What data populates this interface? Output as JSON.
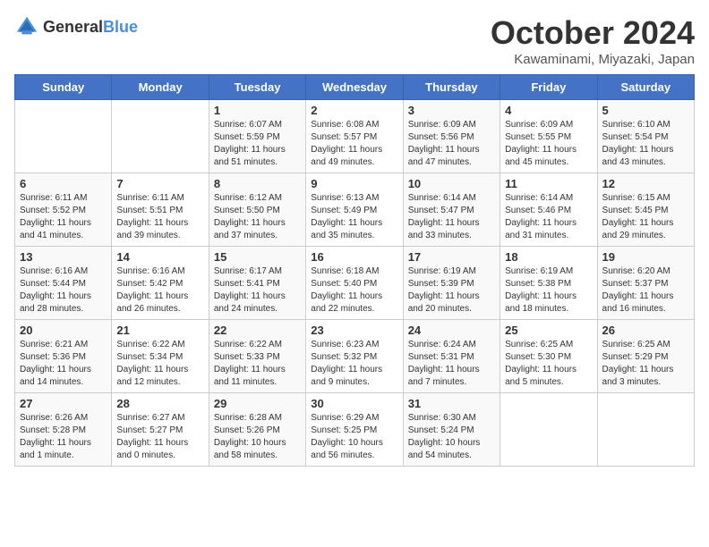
{
  "logo": {
    "text_general": "General",
    "text_blue": "Blue"
  },
  "title": "October 2024",
  "location": "Kawaminami, Miyazaki, Japan",
  "weekdays": [
    "Sunday",
    "Monday",
    "Tuesday",
    "Wednesday",
    "Thursday",
    "Friday",
    "Saturday"
  ],
  "weeks": [
    [
      {
        "day": "",
        "info": ""
      },
      {
        "day": "",
        "info": ""
      },
      {
        "day": "1",
        "info": "Sunrise: 6:07 AM\nSunset: 5:59 PM\nDaylight: 11 hours and 51 minutes."
      },
      {
        "day": "2",
        "info": "Sunrise: 6:08 AM\nSunset: 5:57 PM\nDaylight: 11 hours and 49 minutes."
      },
      {
        "day": "3",
        "info": "Sunrise: 6:09 AM\nSunset: 5:56 PM\nDaylight: 11 hours and 47 minutes."
      },
      {
        "day": "4",
        "info": "Sunrise: 6:09 AM\nSunset: 5:55 PM\nDaylight: 11 hours and 45 minutes."
      },
      {
        "day": "5",
        "info": "Sunrise: 6:10 AM\nSunset: 5:54 PM\nDaylight: 11 hours and 43 minutes."
      }
    ],
    [
      {
        "day": "6",
        "info": "Sunrise: 6:11 AM\nSunset: 5:52 PM\nDaylight: 11 hours and 41 minutes."
      },
      {
        "day": "7",
        "info": "Sunrise: 6:11 AM\nSunset: 5:51 PM\nDaylight: 11 hours and 39 minutes."
      },
      {
        "day": "8",
        "info": "Sunrise: 6:12 AM\nSunset: 5:50 PM\nDaylight: 11 hours and 37 minutes."
      },
      {
        "day": "9",
        "info": "Sunrise: 6:13 AM\nSunset: 5:49 PM\nDaylight: 11 hours and 35 minutes."
      },
      {
        "day": "10",
        "info": "Sunrise: 6:14 AM\nSunset: 5:47 PM\nDaylight: 11 hours and 33 minutes."
      },
      {
        "day": "11",
        "info": "Sunrise: 6:14 AM\nSunset: 5:46 PM\nDaylight: 11 hours and 31 minutes."
      },
      {
        "day": "12",
        "info": "Sunrise: 6:15 AM\nSunset: 5:45 PM\nDaylight: 11 hours and 29 minutes."
      }
    ],
    [
      {
        "day": "13",
        "info": "Sunrise: 6:16 AM\nSunset: 5:44 PM\nDaylight: 11 hours and 28 minutes."
      },
      {
        "day": "14",
        "info": "Sunrise: 6:16 AM\nSunset: 5:42 PM\nDaylight: 11 hours and 26 minutes."
      },
      {
        "day": "15",
        "info": "Sunrise: 6:17 AM\nSunset: 5:41 PM\nDaylight: 11 hours and 24 minutes."
      },
      {
        "day": "16",
        "info": "Sunrise: 6:18 AM\nSunset: 5:40 PM\nDaylight: 11 hours and 22 minutes."
      },
      {
        "day": "17",
        "info": "Sunrise: 6:19 AM\nSunset: 5:39 PM\nDaylight: 11 hours and 20 minutes."
      },
      {
        "day": "18",
        "info": "Sunrise: 6:19 AM\nSunset: 5:38 PM\nDaylight: 11 hours and 18 minutes."
      },
      {
        "day": "19",
        "info": "Sunrise: 6:20 AM\nSunset: 5:37 PM\nDaylight: 11 hours and 16 minutes."
      }
    ],
    [
      {
        "day": "20",
        "info": "Sunrise: 6:21 AM\nSunset: 5:36 PM\nDaylight: 11 hours and 14 minutes."
      },
      {
        "day": "21",
        "info": "Sunrise: 6:22 AM\nSunset: 5:34 PM\nDaylight: 11 hours and 12 minutes."
      },
      {
        "day": "22",
        "info": "Sunrise: 6:22 AM\nSunset: 5:33 PM\nDaylight: 11 hours and 11 minutes."
      },
      {
        "day": "23",
        "info": "Sunrise: 6:23 AM\nSunset: 5:32 PM\nDaylight: 11 hours and 9 minutes."
      },
      {
        "day": "24",
        "info": "Sunrise: 6:24 AM\nSunset: 5:31 PM\nDaylight: 11 hours and 7 minutes."
      },
      {
        "day": "25",
        "info": "Sunrise: 6:25 AM\nSunset: 5:30 PM\nDaylight: 11 hours and 5 minutes."
      },
      {
        "day": "26",
        "info": "Sunrise: 6:25 AM\nSunset: 5:29 PM\nDaylight: 11 hours and 3 minutes."
      }
    ],
    [
      {
        "day": "27",
        "info": "Sunrise: 6:26 AM\nSunset: 5:28 PM\nDaylight: 11 hours and 1 minute."
      },
      {
        "day": "28",
        "info": "Sunrise: 6:27 AM\nSunset: 5:27 PM\nDaylight: 11 hours and 0 minutes."
      },
      {
        "day": "29",
        "info": "Sunrise: 6:28 AM\nSunset: 5:26 PM\nDaylight: 10 hours and 58 minutes."
      },
      {
        "day": "30",
        "info": "Sunrise: 6:29 AM\nSunset: 5:25 PM\nDaylight: 10 hours and 56 minutes."
      },
      {
        "day": "31",
        "info": "Sunrise: 6:30 AM\nSunset: 5:24 PM\nDaylight: 10 hours and 54 minutes."
      },
      {
        "day": "",
        "info": ""
      },
      {
        "day": "",
        "info": ""
      }
    ]
  ]
}
